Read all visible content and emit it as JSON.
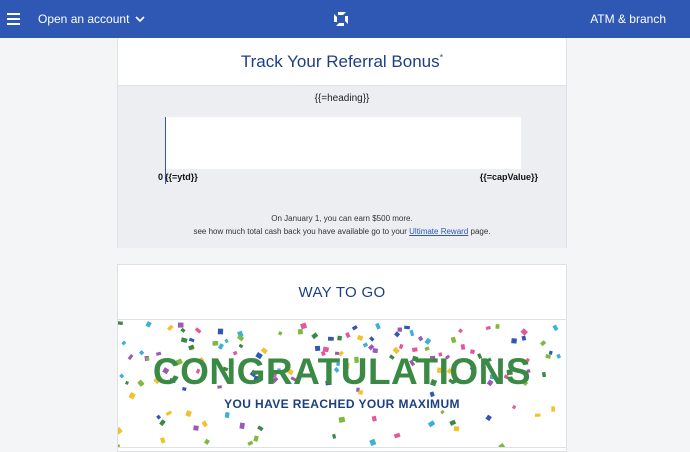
{
  "nav": {
    "open_account_label": "Open an account",
    "atm_label": "ATM & branch"
  },
  "tracker": {
    "title": "Track Your Referral Bonus",
    "title_mark": "*",
    "heading": "{{=heading}}",
    "zero_label": "0",
    "ytd_label": "{{=ytd}}",
    "cap_label": "{{=capValue}}",
    "progress_fraction": 0,
    "note_line1": "On January 1, you can earn $500 more.",
    "note_line2_prefix": "see how much total cash back you have available go to your ",
    "note_link": "Ultimate Reward",
    "note_line2_suffix": " page."
  },
  "celebration": {
    "title": "WAY TO GO",
    "congrats": "CONGRATULATIONS",
    "subtitle": "YOU HAVE REACHED YOUR MAXIMUM"
  },
  "colors": {
    "brand_blue": "#2f57b4",
    "title_navy": "#1c3f84",
    "congrats_green": "#3a8a45",
    "confetti": [
      "#3a8a45",
      "#2f57b4",
      "#f2c12e",
      "#e05a9a",
      "#7fb93d",
      "#3cb0d6",
      "#9b59b6"
    ]
  }
}
